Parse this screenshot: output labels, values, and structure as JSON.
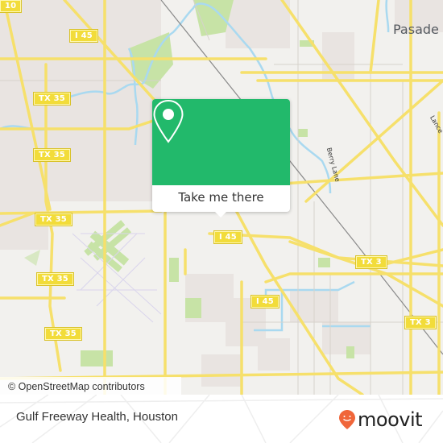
{
  "map": {
    "place_labels": [
      {
        "id": "pasadena",
        "text": "Pasade"
      }
    ],
    "street_labels": [
      {
        "id": "berry-ln",
        "text": "Berry Lane"
      },
      {
        "id": "lance",
        "text": "Lance"
      }
    ],
    "shields": [
      {
        "id": "i10-top",
        "text": "10"
      },
      {
        "id": "i45-north",
        "text": "I 45"
      },
      {
        "id": "tx35-1",
        "text": "TX 35"
      },
      {
        "id": "tx35-2",
        "text": "TX 35"
      },
      {
        "id": "tx35-3",
        "text": "TX 35"
      },
      {
        "id": "tx35-4",
        "text": "TX 35"
      },
      {
        "id": "tx35-5",
        "text": "TX 35"
      },
      {
        "id": "i45-mid",
        "text": "I 45"
      },
      {
        "id": "i45-south",
        "text": "I 45"
      },
      {
        "id": "tx3-1",
        "text": "TX 3"
      },
      {
        "id": "tx3-2",
        "text": "TX 3"
      }
    ],
    "attribution": "© OpenStreetMap contributors",
    "colors": {
      "road": "#f6e06b",
      "water": "#a9d9f0",
      "park": "#c7e3a6",
      "urban": "#e9e4e1",
      "background": "#f2f1ee"
    }
  },
  "popup": {
    "icon": "location-pin-icon",
    "action_label": "Take me there",
    "accent_color": "#22b96b"
  },
  "footer": {
    "place_title": "Gulf Freeway Health, Houston",
    "brand": {
      "name": "moovit",
      "icon": "moovit-smiley-pin-icon",
      "color": "#f0663a"
    }
  }
}
